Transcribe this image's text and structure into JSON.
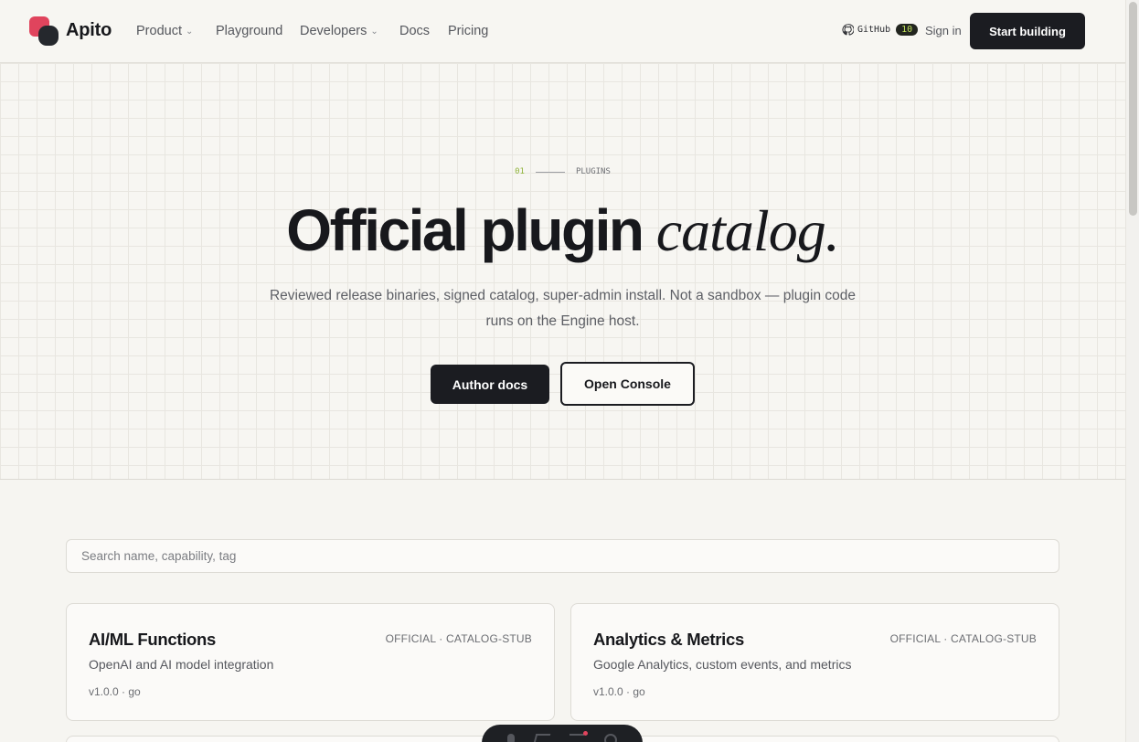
{
  "header": {
    "brand": "Apito",
    "nav": [
      {
        "label": "Product",
        "dropdown": true
      },
      {
        "label": "Playground",
        "dropdown": false
      },
      {
        "label": "Developers",
        "dropdown": true
      },
      {
        "label": "Docs",
        "dropdown": false
      },
      {
        "label": "Pricing",
        "dropdown": false
      }
    ],
    "github_label": "GitHub",
    "github_count": "10",
    "signin": "Sign in",
    "cta": "Start building"
  },
  "hero": {
    "eyebrow_number": "01",
    "eyebrow_label": "PLUGINS",
    "title_main": "Official plugin",
    "title_italic": "catalog.",
    "subtitle": "Reviewed release binaries, signed catalog, super-admin install. Not a sandbox — plugin code runs on the Engine host.",
    "primary_button": "Author docs",
    "secondary_button": "Open Console"
  },
  "catalog": {
    "search_placeholder": "Search name, capability, tag",
    "plugins": [
      {
        "name": "AI/ML Functions",
        "badge": "OFFICIAL · CATALOG-STUB",
        "description": "OpenAI and AI model integration",
        "meta": "v1.0.0 · go"
      },
      {
        "name": "Analytics & Metrics",
        "badge": "OFFICIAL · CATALOG-STUB",
        "description": "Google Analytics, custom events, and metrics",
        "meta": "v1.0.0 · go"
      }
    ]
  },
  "colors": {
    "accent_red": "#e0445d",
    "dark": "#1b1c21",
    "accent_lime": "#8fb33a",
    "background": "#f6f5f1"
  }
}
